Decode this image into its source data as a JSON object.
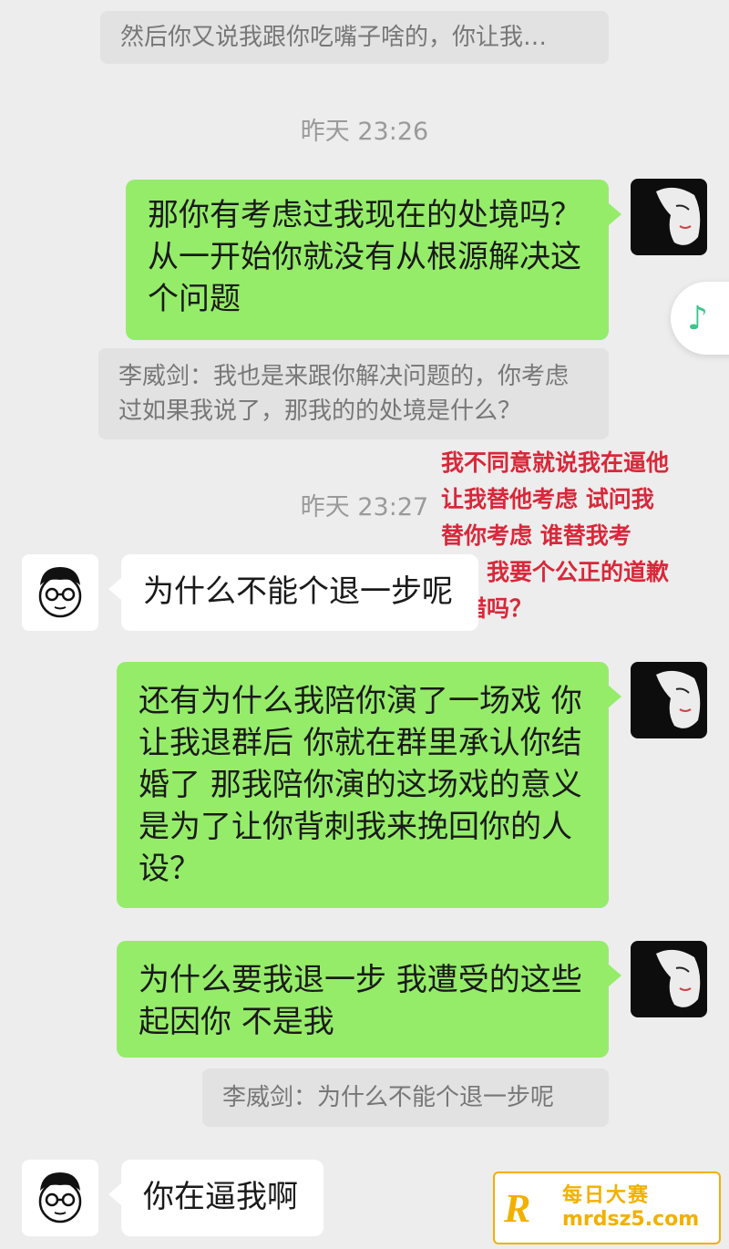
{
  "messages": {
    "top_quote": "然后你又说我跟你吃嘴子啥的，你让我…",
    "time1": "昨天 23:26",
    "msg1": "那你有考虑过我现在的处境吗？从一开始你就没有从根源解决这个问题",
    "quote2": "李威剑：我也是来跟你解决问题的，你考虑过如果我说了，那我的的处境是什么？",
    "time2": "昨天 23:27",
    "msg2": "为什么不能个退一步呢",
    "msg3": "还有为什么我陪你演了一场戏 你让我退群后 你就在群里承认你结婚了 那我陪你演的这场戏的意义是为了让你背刺我来挽回你的人设？",
    "msg4": "为什么要我退一步 我遭受的这些起因你 不是我",
    "quote3": "李威剑：为什么不能个退一步呢",
    "msg5": "你在逼我啊"
  },
  "annotation": "我不同意就说我在逼他 让我替他考虑 试问我替你考虑 谁替我考虑？我要个公正的道歉有错吗？",
  "float_button": {
    "icon": "music-note-icon",
    "glyph": "♪"
  },
  "watermark": {
    "line1": "每日大赛",
    "line2": "mrdsz5.com",
    "logo": "R"
  },
  "colors": {
    "green_bubble": "#95ec69",
    "background": "#ededed",
    "annotation": "#d8283a",
    "watermark": "#f2b000"
  }
}
